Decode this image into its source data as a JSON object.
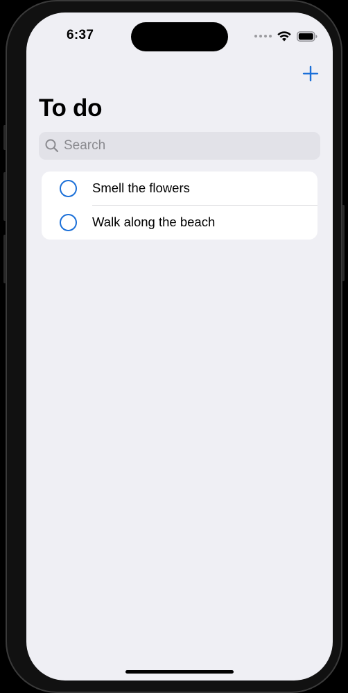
{
  "status_bar": {
    "time": "6:37"
  },
  "nav": {
    "add_icon": "plus-icon",
    "title": "To do"
  },
  "search": {
    "placeholder": "Search",
    "value": "",
    "icon": "search-icon"
  },
  "todos": [
    {
      "label": "Smell the flowers",
      "completed": false
    },
    {
      "label": "Walk along the beach",
      "completed": false
    }
  ],
  "colors": {
    "accent": "#1A6FD8",
    "background": "#EFEFF4",
    "card": "#FFFFFF",
    "search_fill": "#E2E2E8",
    "placeholder": "#8A8A8F"
  }
}
